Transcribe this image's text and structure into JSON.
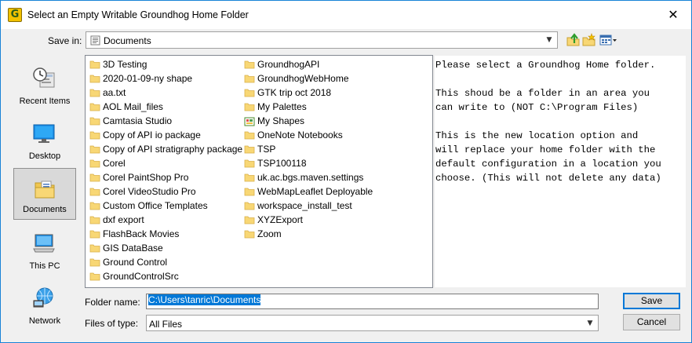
{
  "window": {
    "title": "Select an Empty Writable Groundhog Home Folder",
    "app_icon_letter": "G",
    "close_glyph": "✕"
  },
  "lookin": {
    "label": "Save in:",
    "value": "Documents"
  },
  "places": [
    {
      "label": "Recent Items",
      "icon": "recent-items-icon"
    },
    {
      "label": "Desktop",
      "icon": "desktop-icon"
    },
    {
      "label": "Documents",
      "icon": "documents-icon",
      "selected": true
    },
    {
      "label": "This PC",
      "icon": "this-pc-icon"
    },
    {
      "label": "Network",
      "icon": "network-icon"
    }
  ],
  "files_col1": [
    "3D Testing",
    "2020-01-09-ny shape",
    "aa.txt",
    "AOL Mail_files",
    "Camtasia Studio",
    "Copy of API io package",
    "Copy of API stratigraphy package",
    "Corel",
    "Corel PaintShop Pro",
    "Corel VideoStudio Pro",
    "Custom Office Templates",
    "dxf export",
    "FlashBack Movies",
    "GIS DataBase",
    "Ground Control",
    "GroundControlSrc"
  ],
  "files_col2": [
    "GroundhogAPI",
    "GroundhogWebHome",
    "GTK trip oct 2018",
    "My Palettes",
    "My Shapes",
    "OneNote Notebooks",
    "TSP",
    "TSP100118",
    "uk.ac.bgs.maven.settings",
    "WebMapLeaflet Deployable",
    "workspace_install_test",
    "XYZExport",
    "Zoom"
  ],
  "info": {
    "lines": [
      "Please select a Groundhog Home folder.",
      "",
      "This shoud be a folder in an area you",
      "can write to (NOT C:\\Program Files)",
      "",
      "This is the new location option and",
      "will replace your home folder with the",
      "default configuration in a location you",
      "choose. (This will not delete any data)"
    ]
  },
  "folder_name": {
    "label": "Folder name:",
    "value": "C:\\Users\\tanric\\Documents"
  },
  "files_of_type": {
    "label": "Files of type:",
    "value": "All Files"
  },
  "buttons": {
    "save": "Save",
    "cancel": "Cancel"
  },
  "colors": {
    "accent": "#0078d7",
    "folder": "#f8d775",
    "window_border": "#1883d7"
  }
}
